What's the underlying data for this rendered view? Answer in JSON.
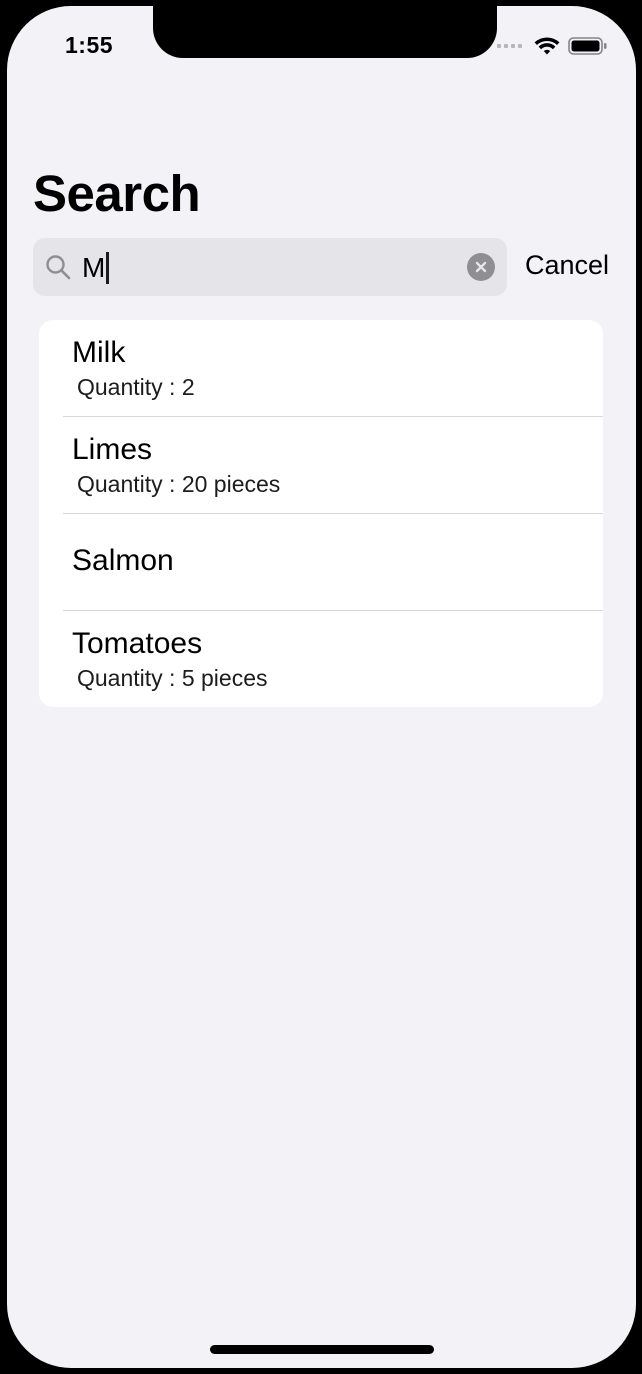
{
  "status_bar": {
    "time": "1:55",
    "wifi_icon": "wifi-icon",
    "battery_icon": "battery-icon"
  },
  "header": {
    "title": "Search"
  },
  "search": {
    "value": "M",
    "search_icon": "magnifying-glass-icon",
    "clear_icon": "clear-x-icon",
    "cancel_label": "Cancel"
  },
  "results": [
    {
      "name": "Milk",
      "quantity": "Quantity : 2"
    },
    {
      "name": "Limes",
      "quantity": "Quantity : 20 pieces"
    },
    {
      "name": "Salmon",
      "quantity": ""
    },
    {
      "name": "Tomatoes",
      "quantity": "Quantity : 5 pieces"
    }
  ],
  "colors": {
    "background": "#f2f2f7",
    "card": "#ffffff",
    "search_field": "#e4e4e9",
    "clear_button": "#8e8e93"
  }
}
